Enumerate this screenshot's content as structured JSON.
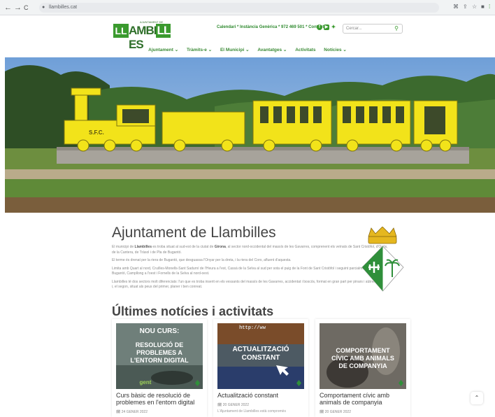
{
  "browser": {
    "back": "←",
    "forward": "→",
    "reload": "C",
    "url": "llambilles.cat"
  },
  "header": {
    "logo_small": "AJUNTAMENT DE",
    "logo_text_a": "AMBI",
    "logo_text_b": "LL",
    "logo_text_c": "ES",
    "toplinks": "Calendari * Instància Genèrica * 972 469 501 * Contacte *",
    "search_placeholder": "Cercar...",
    "menu": [
      "Ajuntament ⌄",
      "Tràmits-e ⌄",
      "El Municipi ⌄",
      "Avantatges ⌄",
      "Activitats",
      "Notícies ⌄"
    ]
  },
  "hero": {
    "train_text": "S.F.C."
  },
  "intro": {
    "title": "Ajuntament de Llambilles",
    "p1_pre": "El municipi de ",
    "p1_b1": "Llambilles",
    "p1_mid": " es troba situat al sud-est de la ciutat de ",
    "p1_b2": "Girona",
    "p1_post": ", al sector nord-occidental del massís de les Gavarres, comprenent els veïnats de Sant Cristòfol, d'Ocós, de la Cantera, de Tràsol i de Pla de Bugantó.",
    "p2": "El terme és drenat per la riera de Bugantó, que desguassa l'Onyar per la dreta, i la riera del Coro, afluent d'aquesta.",
    "p3": "Limita amb Quart al nord, Cruïlles-Monells-Sant Sadurní de l'Heura a l'est, Cassà de la Selva al sud per sota el puig de la Font de Sant Cristòfol i seguint parcialment la riera de Bugantó, Campllong a l'oest i Fornells de la Selva al nord-oest.",
    "p4": "Llambilles té dos sectors molt diferenciats: l'un que es troba inserit en els vessants del massís de les Gavarres, accidentat i boscós, format en gran part per pinars i alzines sureres i, el segon, situat als peus del primer, planer i ben conreat."
  },
  "news": {
    "heading": "Últimes notícies i activitats",
    "items": [
      {
        "img_line1": "NOU CURS:",
        "img_line2": "RESOLUCIÓ DE",
        "img_line3": "PROBLEMES A",
        "img_line4": "L'ENTORN DIGITAL",
        "img_brand": "gent",
        "title": "Curs bàsic de resolució de problemes en l'entorn digital",
        "date": "24 GENER 2022",
        "excerpt": ""
      },
      {
        "img_url": "http://ww",
        "img_line1": "ACTUALITZACIÓ",
        "img_line2": "CONSTANT",
        "title": "Actualització constant",
        "date": "20 GENER 2022",
        "excerpt": "L'Ajuntament de Llambilles està compromès"
      },
      {
        "img_line1": "COMPORTAMENT",
        "img_line2": "CÍVIC AMB ANIMALS",
        "img_line3": "DE COMPANYIA",
        "title": "Comportament cívic amb animals de companyia",
        "date": "20 GENER 2022",
        "excerpt": ""
      }
    ]
  },
  "back_to_top": "⌃"
}
